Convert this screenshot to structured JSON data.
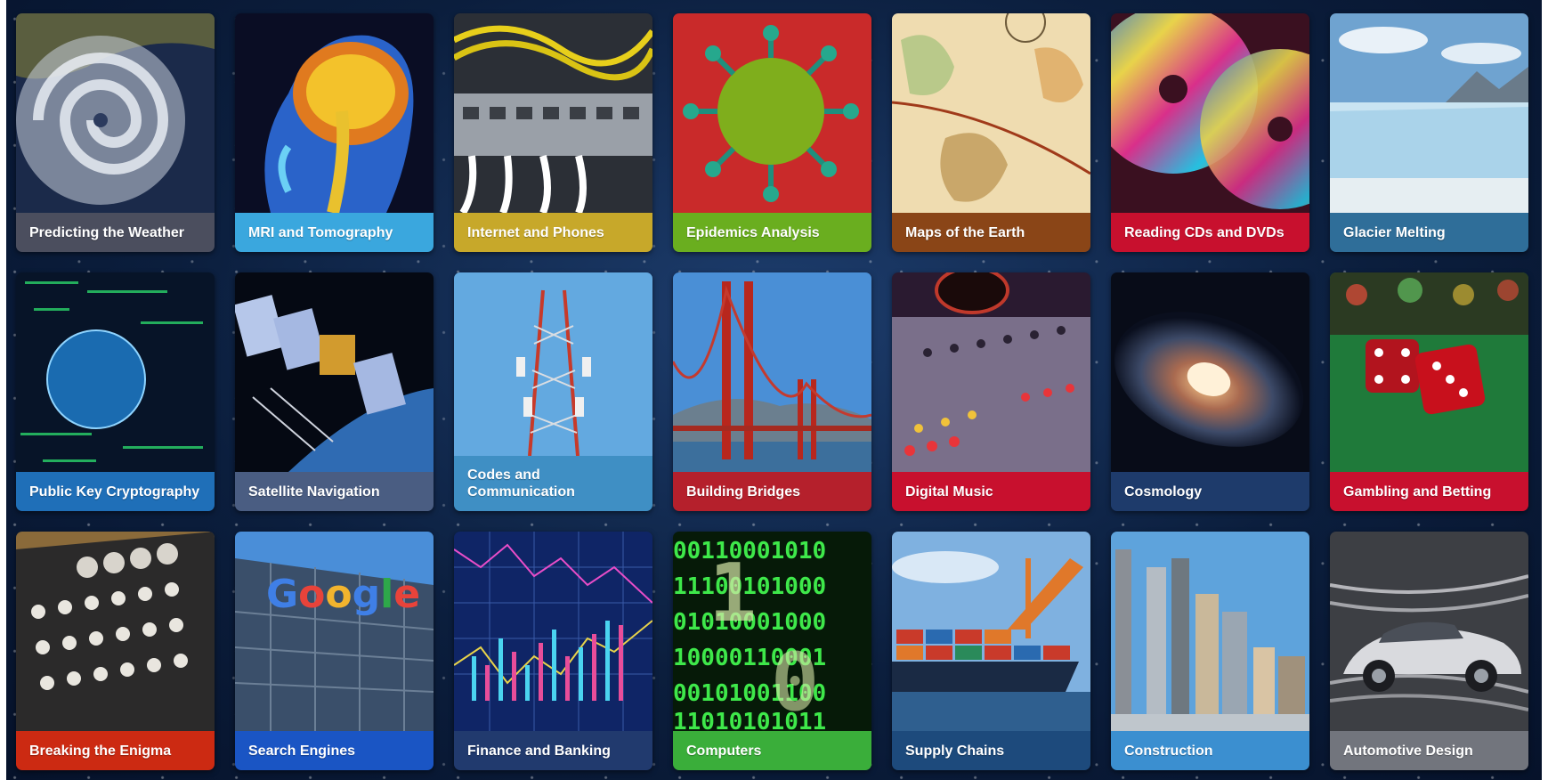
{
  "tiles": [
    {
      "name": "predicting-the-weather",
      "label": "Predicting the Weather",
      "color": "#4b4e5e",
      "icon": "hurricane-image"
    },
    {
      "name": "mri-and-tomography",
      "label": "MRI and Tomography",
      "color": "#3aa7de",
      "icon": "brain-scan-image"
    },
    {
      "name": "internet-and-phones",
      "label": "Internet and Phones",
      "color": "#c7a82a",
      "icon": "network-cables-image"
    },
    {
      "name": "epidemics-analysis",
      "label": "Epidemics Analysis",
      "color": "#6aae1f",
      "icon": "virus-image"
    },
    {
      "name": "maps-of-the-earth",
      "label": "Maps of the Earth",
      "color": "#8a4517",
      "icon": "globe-map-image"
    },
    {
      "name": "reading-cds-and-dvds",
      "label": "Reading CDs and DVDs",
      "color": "#c8102e",
      "icon": "compact-discs-image"
    },
    {
      "name": "glacier-melting",
      "label": "Glacier Melting",
      "color": "#2f6e99",
      "icon": "glacier-image"
    },
    {
      "name": "public-key-cryptography",
      "label": "Public Key Cryptography",
      "color": "#1f6fb8",
      "icon": "digital-globe-image"
    },
    {
      "name": "satellite-navigation",
      "label": "Satellite Navigation",
      "color": "#4a5d82",
      "icon": "satellite-image"
    },
    {
      "name": "codes-and-communication",
      "label": "Codes and Communication",
      "color": "#3f8fc4",
      "icon": "cell-tower-image"
    },
    {
      "name": "building-bridges",
      "label": "Building Bridges",
      "color": "#b5202c",
      "icon": "golden-gate-bridge-image"
    },
    {
      "name": "digital-music",
      "label": "Digital Music",
      "color": "#c8102e",
      "icon": "mixing-console-image"
    },
    {
      "name": "cosmology",
      "label": "Cosmology",
      "color": "#1e3b6b",
      "icon": "galaxy-image"
    },
    {
      "name": "gambling-and-betting",
      "label": "Gambling and Betting",
      "color": "#c8102e",
      "icon": "dice-image"
    },
    {
      "name": "breaking-the-enigma",
      "label": "Breaking the Enigma",
      "color": "#cc2a12",
      "icon": "enigma-machine-image"
    },
    {
      "name": "search-engines",
      "label": "Search Engines",
      "color": "#1a55c4",
      "icon": "google-building-image"
    },
    {
      "name": "finance-and-banking",
      "label": "Finance and Banking",
      "color": "#213a6e",
      "icon": "stock-chart-image"
    },
    {
      "name": "computers",
      "label": "Computers",
      "color": "#3aae3a",
      "icon": "binary-code-image"
    },
    {
      "name": "supply-chains",
      "label": "Supply Chains",
      "color": "#1d4a7c",
      "icon": "container-ship-image"
    },
    {
      "name": "construction",
      "label": "Construction",
      "color": "#3b8fd0",
      "icon": "skyscrapers-image"
    },
    {
      "name": "automotive-design",
      "label": "Automotive Design",
      "color": "#72757d",
      "icon": "car-wind-tunnel-image"
    }
  ]
}
